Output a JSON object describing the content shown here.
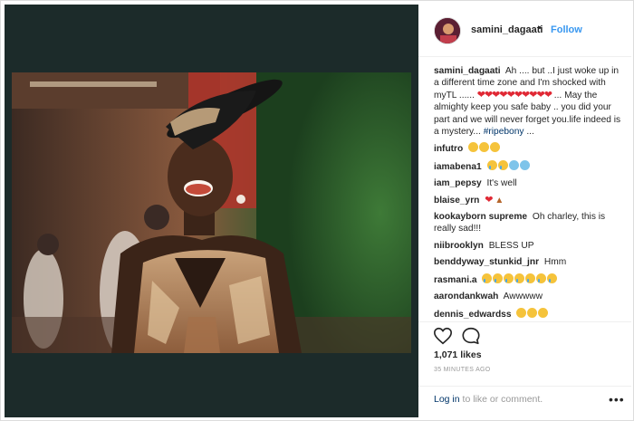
{
  "post": {
    "username": "samini_dagaati",
    "dot": "•",
    "follow_label": "Follow"
  },
  "caption": {
    "username": "samini_dagaati",
    "text_before_hearts": "Ah .... but ..I just woke up in a different time zone and I'm shocked with myTL ......",
    "hearts": "❤❤❤❤❤❤❤❤❤❤",
    "text_after_hearts": "... May the almighty keep you safe baby .. you did your part and we will never forget you.life indeed is a mystery...",
    "hashtag": "#ripebony",
    "trailing": "..."
  },
  "comments": [
    {
      "username": "infutro",
      "text": "",
      "emoji": [
        "sad",
        "sad",
        "sad"
      ]
    },
    {
      "username": "iamabena1",
      "text": "",
      "emoji": [
        "cry",
        "cry",
        "scream",
        "scream"
      ]
    },
    {
      "username": "iam_pepsy",
      "text": "It's well",
      "emoji": []
    },
    {
      "username": "blaise_yrn",
      "text": "",
      "emoji": [
        "heart",
        "pray"
      ]
    },
    {
      "username": "kookayborn supreme",
      "text": "Oh charley, this is really sad!!!",
      "emoji": []
    },
    {
      "username": "niibrooklyn",
      "text": "BLESS UP",
      "emoji": []
    },
    {
      "username": "benddyway_stunkid_jnr",
      "text": "Hmm",
      "emoji": []
    },
    {
      "username": "rasmani.a",
      "text": "",
      "emoji": [
        "cry",
        "cry",
        "cry",
        "cry",
        "cry",
        "cry",
        "cry"
      ]
    },
    {
      "username": "aarondankwah",
      "text": "Awwwww",
      "emoji": []
    },
    {
      "username": "dennis_edwardss",
      "text": "",
      "emoji": [
        "sad",
        "sad",
        "sad"
      ]
    }
  ],
  "stats": {
    "likes": "1,071 likes",
    "time": "35 MINUTES AGO"
  },
  "footer": {
    "login_link": "Log in",
    "login_rest": " to like or comment.",
    "more": "•••"
  },
  "icons": {
    "like": "heart-outline-icon",
    "comment": "speech-bubble-icon",
    "more": "more-options-icon"
  },
  "colors": {
    "link_blue": "#3897f0",
    "hashtag": "#003569",
    "heart_red": "#e02834",
    "photo_panel_bg": "#1c2b2a"
  }
}
